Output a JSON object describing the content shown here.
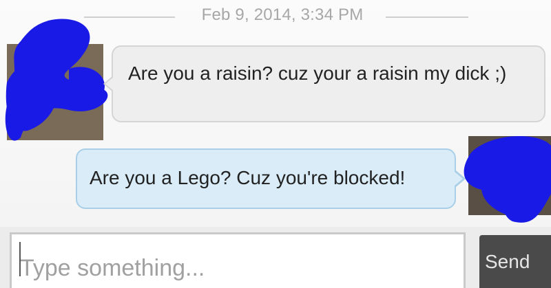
{
  "conversation": {
    "timestamp": "Feb 9, 2014, 3:34 PM",
    "messages": [
      {
        "direction": "incoming",
        "text": "Are you a raisin? cuz your a raisin my dick ;)"
      },
      {
        "direction": "outgoing",
        "text": "Are you a Lego? Cuz you're blocked!"
      }
    ]
  },
  "composer": {
    "placeholder": "Type something...",
    "send_label": "Send"
  },
  "colors": {
    "incoming_bubble": "#eeeeee",
    "outgoing_bubble": "#d9ecf8",
    "redaction": "#1a1ae6",
    "send_button": "#4a4a4a"
  }
}
